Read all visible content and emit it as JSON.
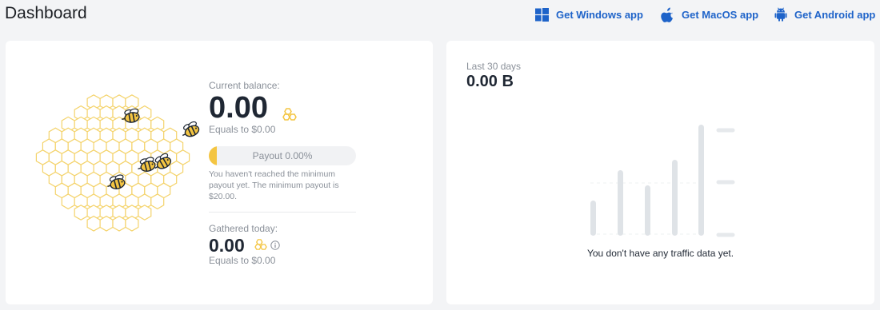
{
  "page": {
    "title": "Dashboard"
  },
  "header": {
    "links": [
      {
        "label": "Get Windows app",
        "icon": "windows-icon"
      },
      {
        "label": "Get MacOS app",
        "icon": "apple-icon"
      },
      {
        "label": "Get Android app",
        "icon": "android-icon"
      }
    ]
  },
  "balance": {
    "label": "Current balance:",
    "value": "0.00",
    "equals": "Equals to $0.00",
    "payout_text": "Payout 0.00%",
    "payout_fraction": 0.0,
    "note": "You haven't reached the minimum payout yet. The minimum payout is $20.00."
  },
  "today": {
    "label": "Gathered today:",
    "value": "0.00",
    "equals": "Equals to $0.00"
  },
  "traffic": {
    "label": "Last 30 days",
    "value": "0.00 B",
    "empty_message": "You don't have any traffic data yet."
  },
  "colors": {
    "accent": "#1e63c9",
    "honey": "#f4c542",
    "placeholder_bar": "#dfe3e7"
  }
}
